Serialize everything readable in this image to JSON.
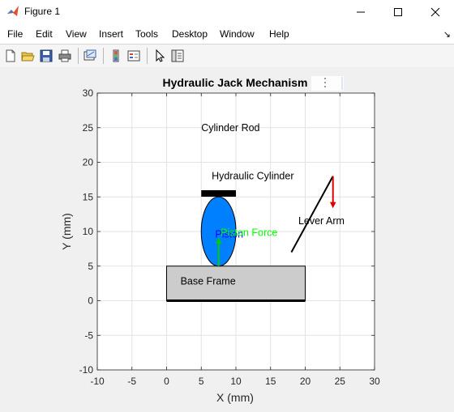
{
  "window": {
    "title": "Figure 1",
    "controls": [
      "minimize",
      "maximize",
      "close"
    ]
  },
  "menu": {
    "items": [
      "File",
      "Edit",
      "View",
      "Insert",
      "Tools",
      "Desktop",
      "Window",
      "Help"
    ],
    "dock_arrow": "↘"
  },
  "toolbar": {
    "buttons": [
      "new-figure-icon",
      "open-file-icon",
      "save-icon",
      "print-icon",
      "link-plot-icon",
      "insert-colorbar-icon",
      "insert-legend-icon",
      "edit-plot-icon",
      "property-inspector-icon"
    ]
  },
  "chart_data": {
    "type": "diagram-plot",
    "title": "Hydraulic Jack Mechanism",
    "xlabel": "X (mm)",
    "ylabel": "Y (mm)",
    "xlim": [
      -10,
      30
    ],
    "ylim": [
      -10,
      30
    ],
    "xticks": [
      -10,
      -5,
      0,
      5,
      10,
      15,
      20,
      25,
      30
    ],
    "yticks": [
      -10,
      -5,
      0,
      5,
      10,
      15,
      20,
      25,
      30
    ],
    "grid": true,
    "base_frame": {
      "x": [
        0,
        20
      ],
      "y": [
        0,
        5
      ],
      "label": "Base Frame",
      "fill": "#cccccc"
    },
    "base_line": {
      "x": [
        0,
        20
      ],
      "y": 0
    },
    "piston_ellipse": {
      "cx": 7.5,
      "cy": 10,
      "rx": 2.5,
      "ry": 5,
      "fill": "#0080ff"
    },
    "cylinder_cap": {
      "x": [
        5,
        10
      ],
      "y": 15.5
    },
    "lever_arm": {
      "x": [
        18,
        24
      ],
      "y": [
        7,
        18
      ],
      "label": "Lever Arm"
    },
    "piston_force_arrow": {
      "x": 7.5,
      "y_from": 5,
      "y_to": 9,
      "color": "#00cc00",
      "label": "Piston Force"
    },
    "lever_force_arrow": {
      "x": 24,
      "y_from": 18,
      "y_to": 13.5,
      "color": "#dd0000"
    },
    "annotations": [
      {
        "text": "Cylinder Rod",
        "x": 5,
        "y": 25,
        "color": "#000000"
      },
      {
        "text": "Hydraulic Cylinder",
        "x": 6.5,
        "y": 18,
        "color": "#000000"
      },
      {
        "text": "Lever Arm",
        "x": 19,
        "y": 11.5,
        "color": "#000000"
      },
      {
        "text": "Base Frame",
        "x": 2,
        "y": 2.8,
        "color": "#000000"
      },
      {
        "text": "Piston",
        "x": 7,
        "y": 9.6,
        "color": "#0000ff"
      },
      {
        "text": "Piston Force",
        "x": 7.8,
        "y": 9.8,
        "color": "#00ff00"
      }
    ]
  },
  "colors": {
    "accent": "#0072bd",
    "plot_bg": "#ffffff",
    "figure_bg": "#f0f0f0"
  }
}
